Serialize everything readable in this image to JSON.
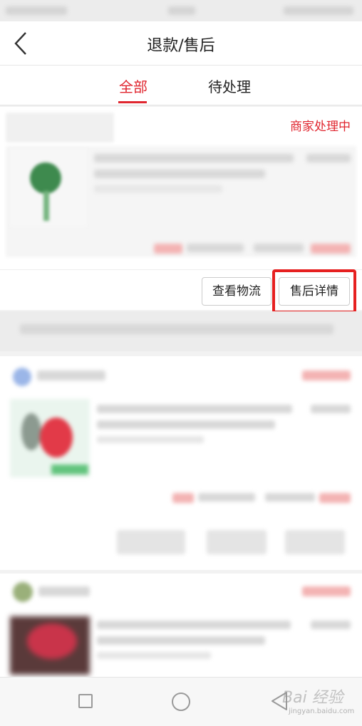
{
  "header": {
    "title": "退款/售后"
  },
  "tabs": [
    {
      "label": "全部",
      "active": true
    },
    {
      "label": "待处理",
      "active": false
    }
  ],
  "order": {
    "status": "商家处理中",
    "buttons": {
      "logistics": "查看物流",
      "detail": "售后详情"
    }
  },
  "colors": {
    "accent": "#e0262f",
    "highlight": "#e62020"
  },
  "icons": {
    "back": "chevron-left-icon",
    "nav_home": "square-icon",
    "nav_circle": "circle-icon",
    "nav_back": "triangle-back-icon"
  },
  "watermark": {
    "brand": "Bai 经验",
    "url": "jingyan.baidu.com"
  }
}
